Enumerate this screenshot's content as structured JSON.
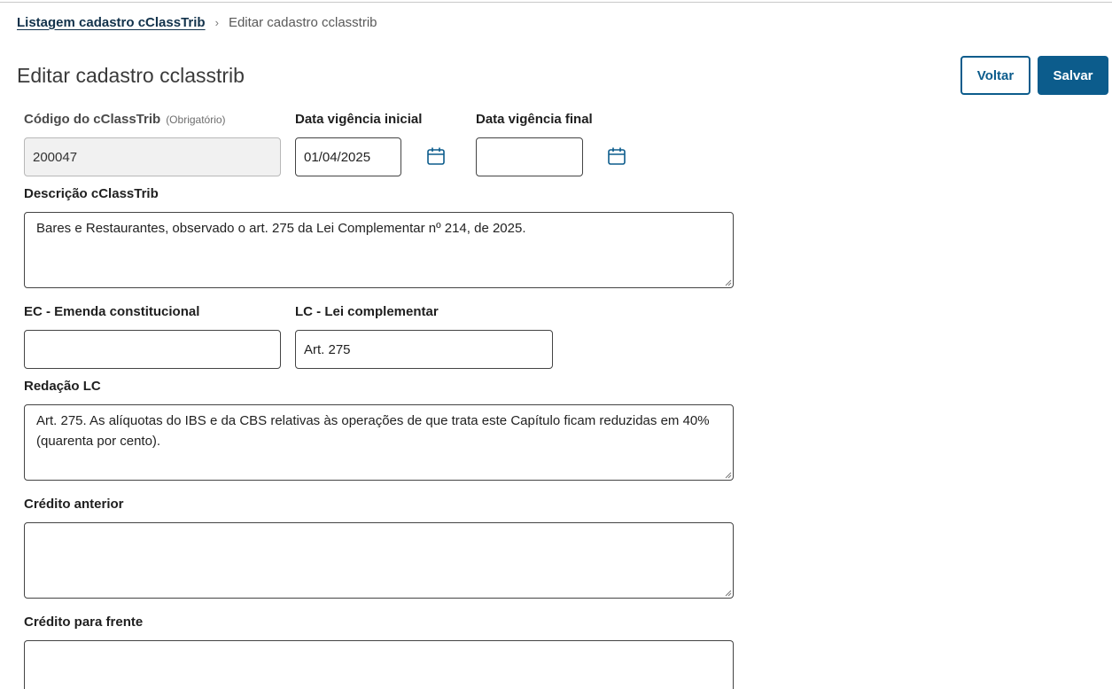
{
  "breadcrumb": {
    "parent": "Listagem cadastro cClassTrib",
    "separator": "›",
    "current": "Editar cadastro cclasstrib"
  },
  "page": {
    "title": "Editar cadastro cclasstrib"
  },
  "actions": {
    "back_label": "Voltar",
    "save_label": "Salvar"
  },
  "form": {
    "codigo": {
      "label": "Código do cClassTrib",
      "hint": "(Obrigatório)",
      "value": "200047"
    },
    "data_inicial": {
      "label": "Data vigência inicial",
      "value": "01/04/2025"
    },
    "data_final": {
      "label": "Data vigência final",
      "value": ""
    },
    "descricao": {
      "label": "Descrição cClassTrib",
      "value": "Bares e Restaurantes, observado o art. 275 da Lei Complementar nº 214, de 2025."
    },
    "ec": {
      "label": "EC - Emenda constitucional",
      "value": ""
    },
    "lc": {
      "label": "LC - Lei complementar",
      "value": "Art. 275"
    },
    "redacao": {
      "label": "Redação LC",
      "value": "Art. 275. As alíquotas do IBS e da CBS relativas às operações de que trata este Capítulo ficam reduzidas em 40% (quarenta por cento)."
    },
    "credito_anterior": {
      "label": "Crédito anterior",
      "value": ""
    },
    "credito_frente": {
      "label": "Crédito para frente",
      "value": ""
    }
  },
  "colors": {
    "primary": "#0c5c8c",
    "link": "#12324b",
    "disabled_bg": "#f1f1f1"
  },
  "icons": {
    "calendar": "calendar-icon",
    "separator": "chevron-right-icon"
  }
}
